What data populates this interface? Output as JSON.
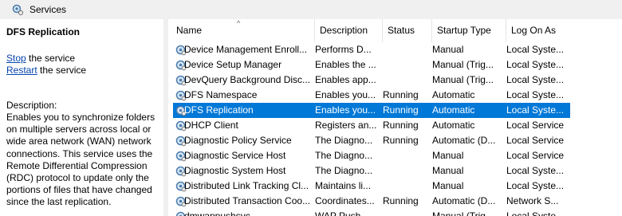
{
  "window": {
    "title": "Services"
  },
  "details": {
    "service_title": "DFS Replication",
    "actions": [
      {
        "link": "Stop",
        "rest": " the service"
      },
      {
        "link": "Restart",
        "rest": " the service"
      }
    ],
    "description_label": "Description:",
    "description": "Enables you to synchronize folders on multiple servers across local or wide area network (WAN) network connections. This service uses the Remote Differential Compression (RDC) protocol to update only the portions of files that have changed since the last replication."
  },
  "table": {
    "columns": [
      "Name",
      "Description",
      "Status",
      "Startup Type",
      "Log On As"
    ],
    "sort_indicator": "^",
    "selected_index": 4,
    "rows": [
      {
        "name": "Device Management Enroll...",
        "description": "Performs D...",
        "status": "",
        "startup": "Manual",
        "logon": "Local Syste..."
      },
      {
        "name": "Device Setup Manager",
        "description": "Enables the ...",
        "status": "",
        "startup": "Manual (Trig...",
        "logon": "Local Syste..."
      },
      {
        "name": "DevQuery Background Disc...",
        "description": "Enables app...",
        "status": "",
        "startup": "Manual (Trig...",
        "logon": "Local Syste..."
      },
      {
        "name": "DFS Namespace",
        "description": "Enables you...",
        "status": "Running",
        "startup": "Automatic",
        "logon": "Local Syste..."
      },
      {
        "name": "DFS Replication",
        "description": "Enables you...",
        "status": "Running",
        "startup": "Automatic",
        "logon": "Local Syste..."
      },
      {
        "name": "DHCP Client",
        "description": "Registers an...",
        "status": "Running",
        "startup": "Automatic",
        "logon": "Local Service"
      },
      {
        "name": "Diagnostic Policy Service",
        "description": "The Diagno...",
        "status": "Running",
        "startup": "Automatic (D...",
        "logon": "Local Service"
      },
      {
        "name": "Diagnostic Service Host",
        "description": "The Diagno...",
        "status": "",
        "startup": "Manual",
        "logon": "Local Service"
      },
      {
        "name": "Diagnostic System Host",
        "description": "The Diagno...",
        "status": "",
        "startup": "Manual",
        "logon": "Local Syste..."
      },
      {
        "name": "Distributed Link Tracking Cl...",
        "description": "Maintains li...",
        "status": "",
        "startup": "Manual",
        "logon": "Local Syste..."
      },
      {
        "name": "Distributed Transaction Coo...",
        "description": "Coordinates...",
        "status": "Running",
        "startup": "Automatic (D...",
        "logon": "Network S..."
      },
      {
        "name": "dmwappushsvc",
        "description": "WAP Push ...",
        "status": "",
        "startup": "Manual (Trig...",
        "logon": "Local Syste..."
      }
    ]
  },
  "colors": {
    "selection": "#0078d7",
    "link": "#0645ad",
    "titlebar": "#f0f0f0"
  },
  "icons": {
    "window": "services-gear-icon",
    "row": "service-gear-icon"
  }
}
